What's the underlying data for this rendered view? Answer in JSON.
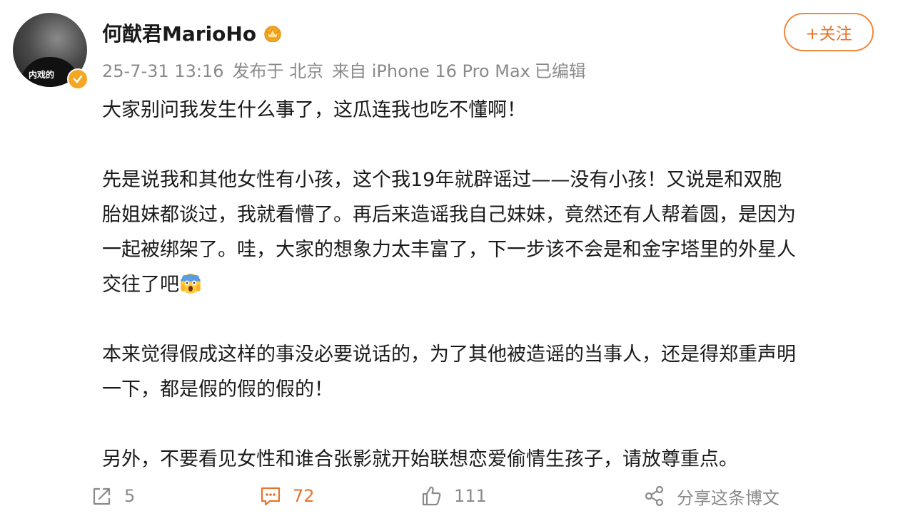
{
  "author": {
    "name": "何猷君MarioHo",
    "avatar_text": "内戏的"
  },
  "follow_button": {
    "label": "+关注"
  },
  "meta": {
    "time": "25-7-31 13:16",
    "location": "发布于 北京",
    "device": "来自 iPhone 16 Pro Max",
    "edited": "已编辑"
  },
  "post": {
    "p1": "大家别问我发生什么事了，这瓜连我也吃不懂啊！",
    "p2_l1": "先是说我和其他女性有小孩，这个我19年就辟谣过——没有小孩！又说是和双胞",
    "p2_l2": "胎姐妹都谈过，我就看懵了。再后来造谣我自己妹妹，竟然还有人帮着圆，是因为",
    "p2_l3": "一起被绑架了。哇，大家的想象力太丰富了，下一步该不会是和金字塔里的外星人",
    "p2_l4": "交往了吧",
    "p3_l1": "本来觉得假成这样的事没必要说话的，为了其他被造谣的当事人，还是得郑重声明",
    "p3_l2": "一下，都是假的假的假的！",
    "p4": "另外，不要看见女性和谁合张影就开始联想恋爱偷情生孩子，请放尊重点。"
  },
  "actions": {
    "repost_count": "5",
    "comment_count": "72",
    "like_count": "111",
    "share_label": "分享这条博文"
  },
  "colors": {
    "accent": "#e8732a",
    "muted": "#8a8a8a",
    "verified": "#f5a623"
  }
}
